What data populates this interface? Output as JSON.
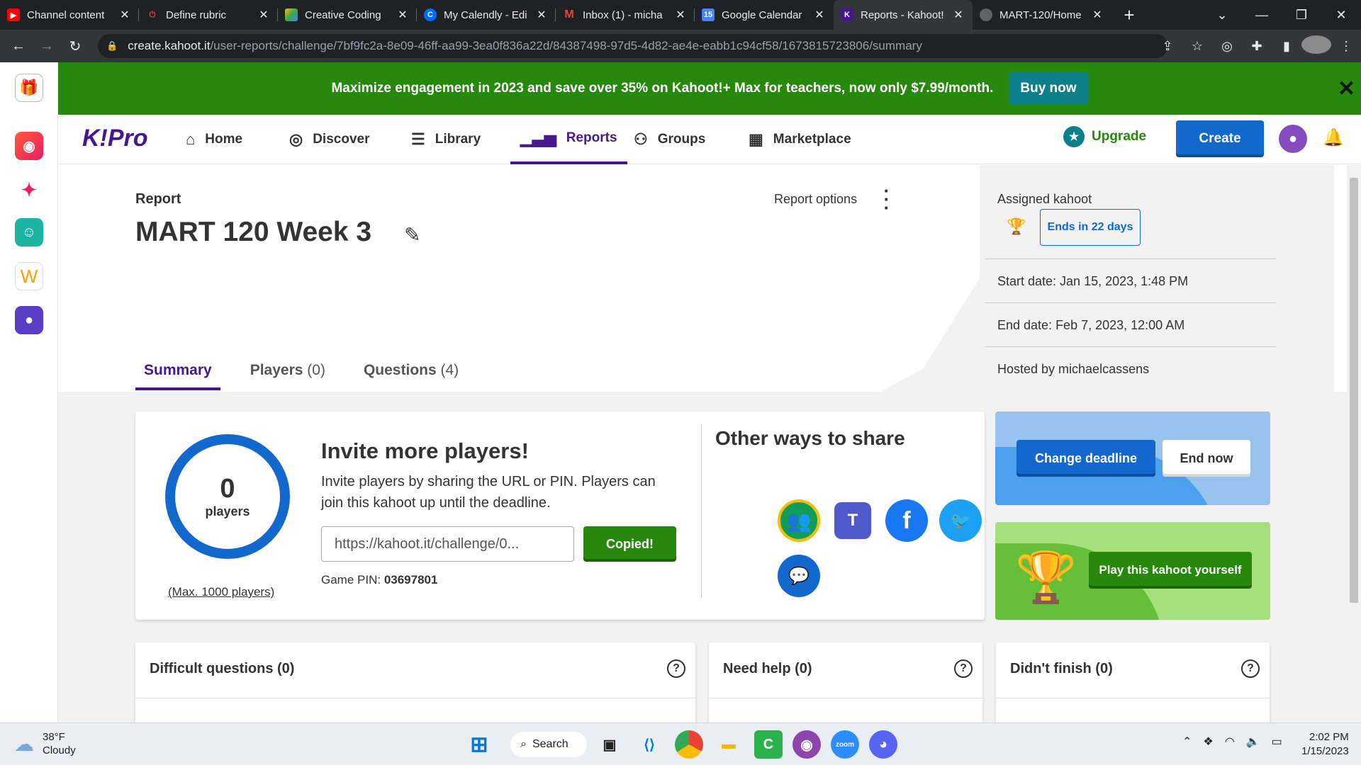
{
  "browser": {
    "tabs": [
      {
        "title": "Channel content",
        "icon": "youtube-icon",
        "color": "#ff0000"
      },
      {
        "title": "Define rubric",
        "icon": "power-icon",
        "color": "#202124"
      },
      {
        "title": "Creative Coding",
        "icon": "drive-icon",
        "color": "#34a853"
      },
      {
        "title": "My Calendly - Edi",
        "icon": "calendly-icon",
        "color": "#006bff"
      },
      {
        "title": "Inbox (1) - micha",
        "icon": "gmail-icon",
        "color": "#ea4335"
      },
      {
        "title": "Google Calendar",
        "icon": "calendar-icon",
        "color": "#4285f4"
      },
      {
        "title": "Reports - Kahoot!",
        "icon": "kahoot-icon",
        "color": "#46178f"
      },
      {
        "title": "MART-120/Home",
        "icon": "github-icon",
        "color": "#202124"
      }
    ],
    "url_host": "create.kahoot.it",
    "url_path": "/user-reports/challenge/7bf9fc2a-8e09-46ff-aa99-3ea0f836a22d/84387498-97d5-4d82-ae4e-eabb1c94cf58/1673815723806/summary"
  },
  "banner": {
    "text": "Maximize engagement in 2023 and save over 35% on Kahoot!+ Max for teachers, now only $7.99/month.",
    "button": "Buy now"
  },
  "nav": {
    "logo": "K!Pro",
    "items": [
      "Home",
      "Discover",
      "Library",
      "Reports",
      "Groups",
      "Marketplace"
    ],
    "upgrade": "Upgrade",
    "create": "Create"
  },
  "report": {
    "label": "Report",
    "title": "MART 120 Week 3",
    "options": "Report options",
    "tabs": [
      {
        "label": "Summary",
        "count": ""
      },
      {
        "label": "Players",
        "count": "(0)"
      },
      {
        "label": "Questions",
        "count": "(4)"
      }
    ]
  },
  "assigned": {
    "label": "Assigned kahoot",
    "ends": "Ends in 22 days",
    "start": "Start date:  Jan 15, 2023, 1:48 PM",
    "end": "End date:  Feb 7, 2023, 12:00 AM",
    "host": "Hosted by michaelcassens"
  },
  "invite": {
    "count": "0",
    "count_label": "players",
    "max": "(Max. 1000 players)",
    "title": "Invite more players!",
    "desc": "Invite players by sharing the URL or PIN. Players can join this kahoot up until the deadline.",
    "url": "https://kahoot.it/challenge/0...",
    "copied": "Copied!",
    "pin_label": "Game PIN: ",
    "pin": "03697801"
  },
  "share": {
    "title": "Other ways to share",
    "icons": [
      "google-classroom-icon",
      "microsoft-teams-icon",
      "facebook-icon",
      "twitter-icon",
      "chat-icon"
    ]
  },
  "actions": {
    "change_deadline": "Change deadline",
    "end_now": "End now",
    "play": "Play this kahoot yourself"
  },
  "bottom": {
    "difficult": "Difficult questions (0)",
    "help": "Need help (0)",
    "unfinished": "Didn't finish (0)"
  },
  "taskbar": {
    "temp": "38°F",
    "condition": "Cloudy",
    "search": "Search",
    "time": "2:02 PM",
    "date": "1/15/2023"
  },
  "colors": {
    "kahoot_purple": "#46178f",
    "green": "#26890c",
    "blue": "#1368ce"
  }
}
